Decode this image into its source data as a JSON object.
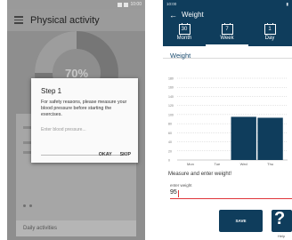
{
  "left": {
    "status_time": "10:00",
    "title": "Physical activity",
    "progress_percent_label": "70%",
    "dialog": {
      "title": "Step 1",
      "body": "For safety reasons, please measure your blood pressure before starting the exercises.",
      "placeholder": "Enter blood pressure...",
      "okay": "OKAY",
      "skip": "SKIP"
    },
    "footer_label": "Daily activities"
  },
  "right": {
    "status_time": "10:00",
    "title": "Weight",
    "tabs": [
      {
        "label": "Month",
        "icon_num": "30"
      },
      {
        "label": "Week",
        "icon_num": "7"
      },
      {
        "label": "Day",
        "icon_num": "1"
      }
    ],
    "section_title": "Weight",
    "prompt": "Measure and enter weight!",
    "input_label": "enter weight",
    "input_value": "95",
    "save": "SAVE",
    "help": "Help"
  },
  "chart_data": {
    "type": "bar",
    "categories": [
      "Mon",
      "Tue",
      "Wed",
      "Thu"
    ],
    "values": [
      0,
      0,
      95,
      93
    ],
    "ylim": [
      0,
      180
    ],
    "yticks": [
      0,
      20,
      40,
      60,
      80,
      100,
      120,
      140,
      160,
      180
    ],
    "color": "#0f3d5c"
  }
}
